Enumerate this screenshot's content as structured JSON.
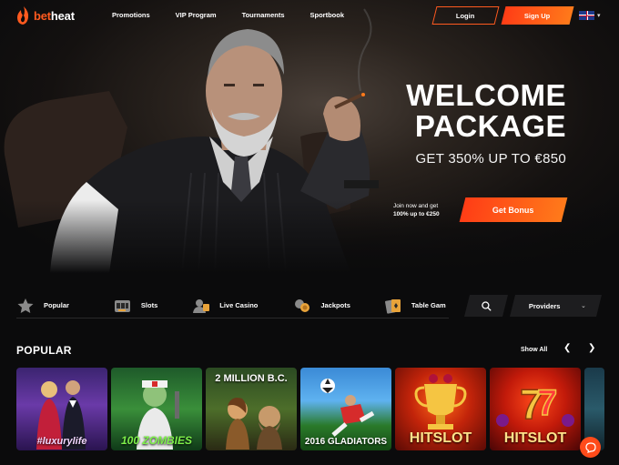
{
  "header": {
    "logo_text": "betheat",
    "logo_prefix": "bet",
    "logo_suffix": "heat",
    "nav": [
      "Promotions",
      "VIP Program",
      "Tournaments",
      "Sportbook"
    ],
    "login_label": "Login",
    "signup_label": "Sign Up",
    "language_icon": "uk-flag-icon"
  },
  "hero": {
    "title_line1": "WELCOME",
    "title_line2": "PACKAGE",
    "subtitle": "GET 350% UP TO €850",
    "join_line1": "Join now and get",
    "join_line2": "100% up to €250",
    "cta_label": "Get Bonus"
  },
  "categories": [
    {
      "label": "Popular",
      "icon": "star-icon"
    },
    {
      "label": "Slots",
      "icon": "slot-machine-icon"
    },
    {
      "label": "Live Casino",
      "icon": "live-dealer-icon"
    },
    {
      "label": "Jackpots",
      "icon": "coins-icon"
    },
    {
      "label": "Table Gam",
      "icon": "cards-icon"
    }
  ],
  "search_icon": "search-icon",
  "providers_label": "Providers",
  "popular": {
    "title": "POPULAR",
    "show_all": "Show All",
    "games": [
      {
        "name": "#luxurylife"
      },
      {
        "name": "100 ZOMBIES"
      },
      {
        "name": "2 MILLION B.C."
      },
      {
        "name": "2016 GLADIATORS"
      },
      {
        "name": "HITSLOT"
      },
      {
        "name": "HITSLOT"
      }
    ]
  },
  "colors": {
    "accent": "#ff5a1f",
    "accent_gradient_start": "#ff3d16",
    "accent_gradient_end": "#ff7a1a",
    "background": "#0b0b0c",
    "control_bg": "#1d1d1f"
  }
}
